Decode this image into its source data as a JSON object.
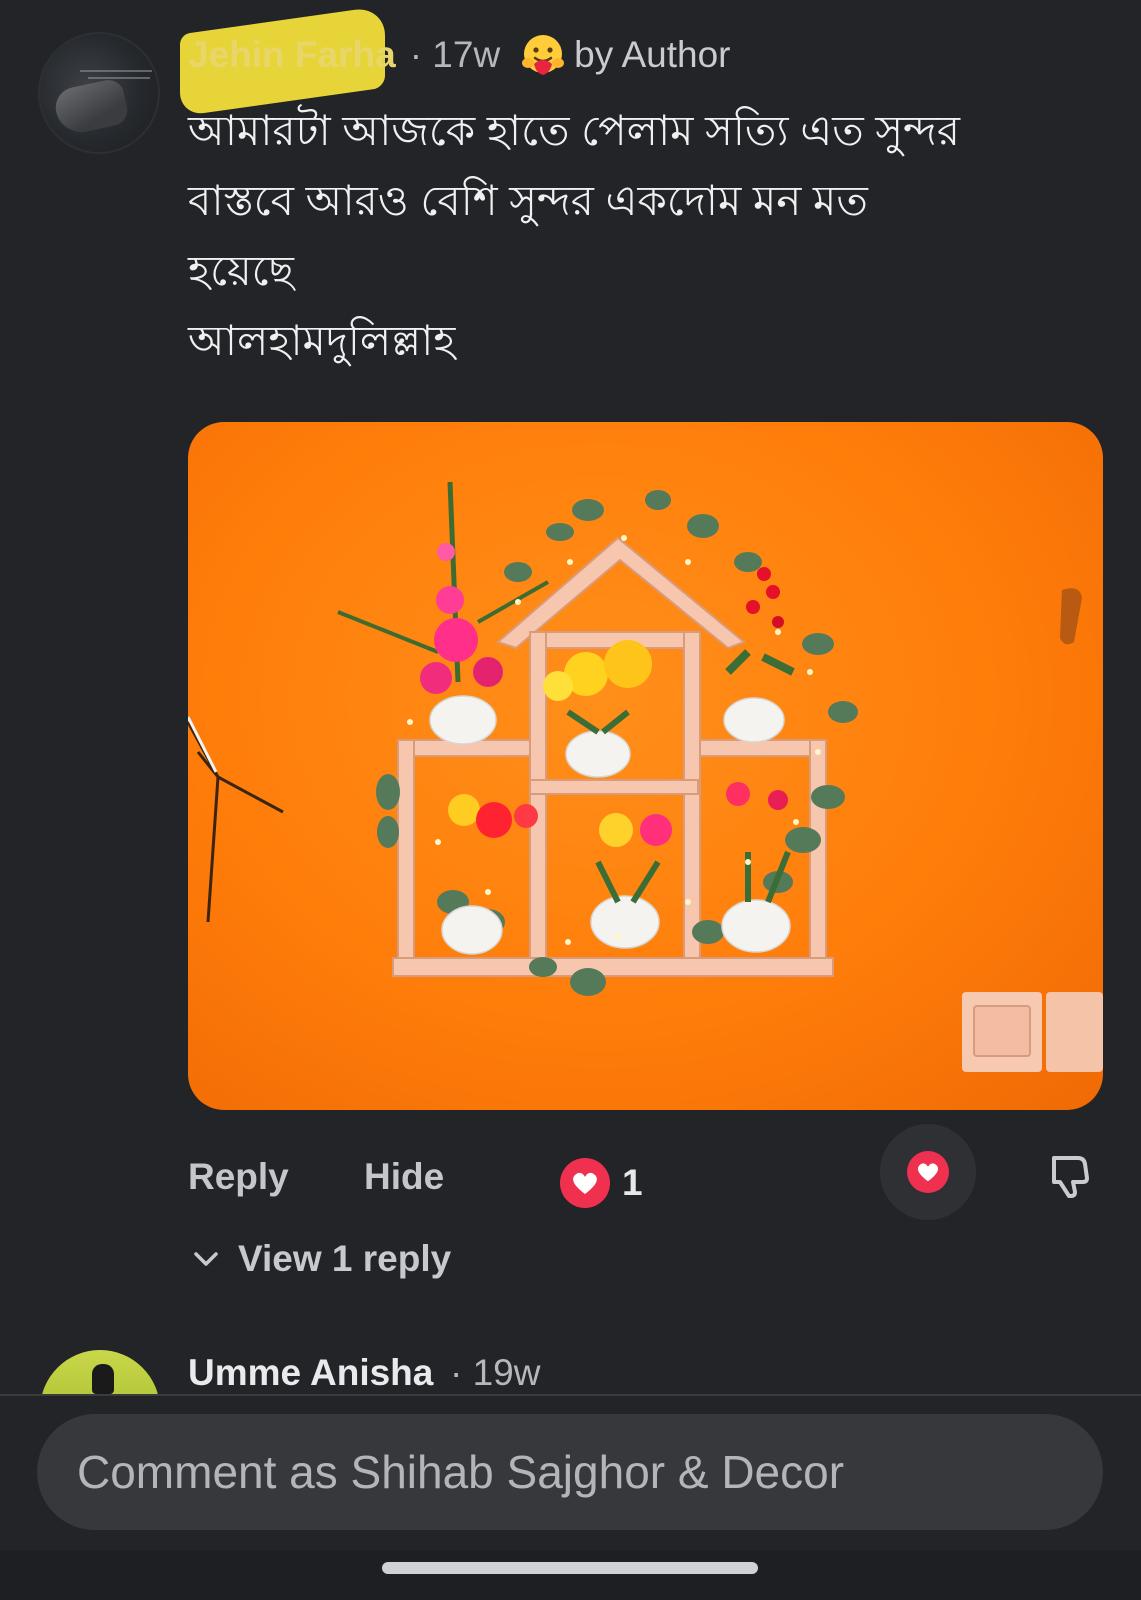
{
  "comment": {
    "author_name": "Jehin Farha",
    "time": "· 17w",
    "author_badge_label": "by Author",
    "author_badge_icon": "hugging-face-emoji-icon",
    "text": "আমারটা আজকে হাতে পেলাম সত্যি এত সুন্দর\nবাস্তবে আরও বেশি সুন্দর একদোম মন মত\nহয়েছে\nআলহামদুলিল্লাহ",
    "reply_label": "Reply",
    "hide_label": "Hide",
    "like_count": "1",
    "view_replies_label": "View 1 reply"
  },
  "next_comment": {
    "author_name": "Umme Anisha",
    "time": "· 19w"
  },
  "composer": {
    "placeholder": "Comment as Shihab Sajghor & Decor"
  },
  "colors": {
    "background": "#232427",
    "like_red": "#f0304f",
    "photo_orange": "#ff7d0a"
  }
}
